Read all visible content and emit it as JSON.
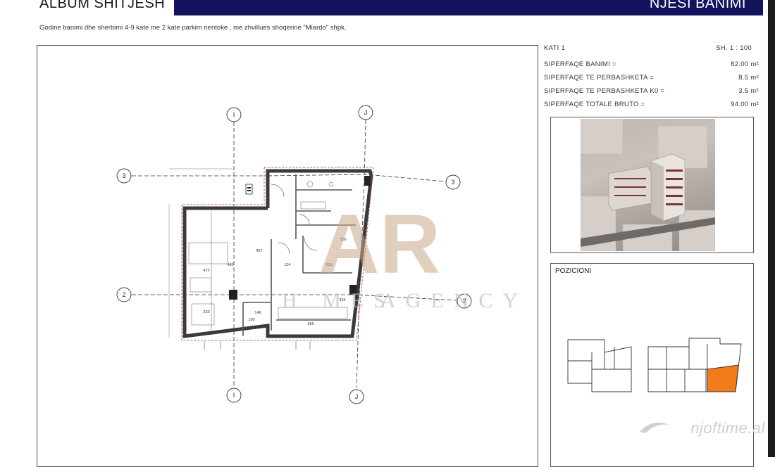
{
  "header": {
    "album_title": "ALBUM SHITJESH",
    "section_title": "NJESI BANIMI",
    "description": "Godine banimi dhe sherbimi 4-9 kate me 2 kate parkim nentoke , me zhvillues shoqerine \"Miardo\" shpk."
  },
  "info": {
    "floor": "KATI 1",
    "scale": "SH.  1 : 100",
    "rows": [
      {
        "label": "SIPERFAQE BANIMI =",
        "value": "82.00 m²"
      },
      {
        "label": "SIPERFAQE TE PERBASHKETA  =",
        "value": "8.5 m²"
      },
      {
        "label": "SIPERFAQE TE PERBASHKETA K0  =",
        "value": "3.5 m²"
      },
      {
        "label": "SIPERFAQE TOTALE BRUTO =",
        "value": "94.00 m²"
      }
    ]
  },
  "pozicioni": {
    "title": "POZICIONI"
  },
  "plan": {
    "grid_labels": {
      "i": "I",
      "j": "J",
      "three": "3",
      "two": "2"
    },
    "dimensions": [
      "480",
      "124",
      "201",
      "457",
      "472",
      "350",
      "233",
      "180",
      "148",
      "356",
      "324"
    ],
    "logo_letters": "AR",
    "agency_text": "AGENCY",
    "agency_prefix": "H MES"
  },
  "watermark": {
    "text": "njoftime.al"
  },
  "colors": {
    "header_band": "#13135e",
    "highlight_unit": "#f07c1a",
    "logo_gold": "#c9a98a"
  },
  "icons": [
    "stairs-icon",
    "swoosh-icon"
  ]
}
